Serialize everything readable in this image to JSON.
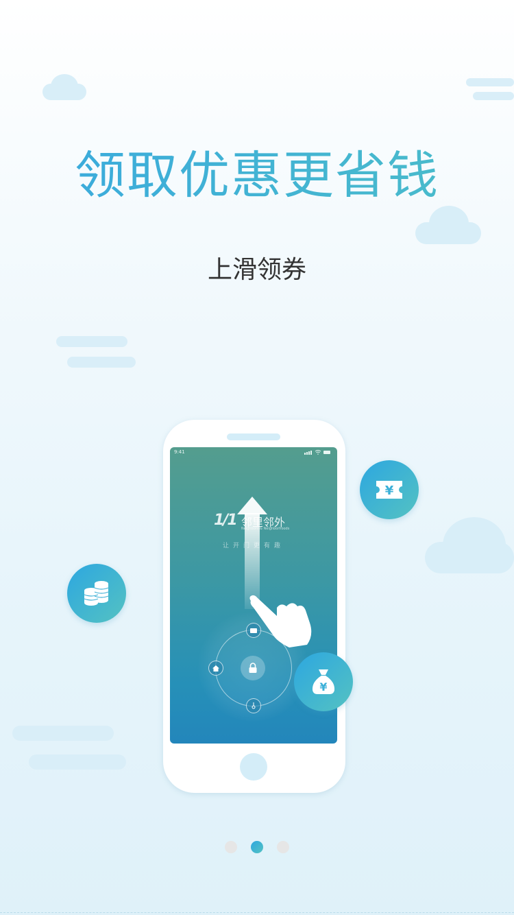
{
  "headline": "领取优惠更省钱",
  "subline": "上滑领券",
  "phone_screen": {
    "status_time": "9:41",
    "logo_mark": "1/1",
    "logo_text": "邻里邻外",
    "logo_subtitle": "Neighbors & Neighborhoods",
    "slogan": "让开门更有趣"
  },
  "floating_icons": [
    "ticket-yen-icon",
    "coins-stack-icon",
    "money-bag-yen-icon"
  ],
  "pager": {
    "count": 3,
    "active_index": 1
  },
  "colors": {
    "accent_start": "#2da7e0",
    "accent_end": "#54c2c2",
    "cloud": "#d8eef8",
    "text_dark": "#333333"
  }
}
